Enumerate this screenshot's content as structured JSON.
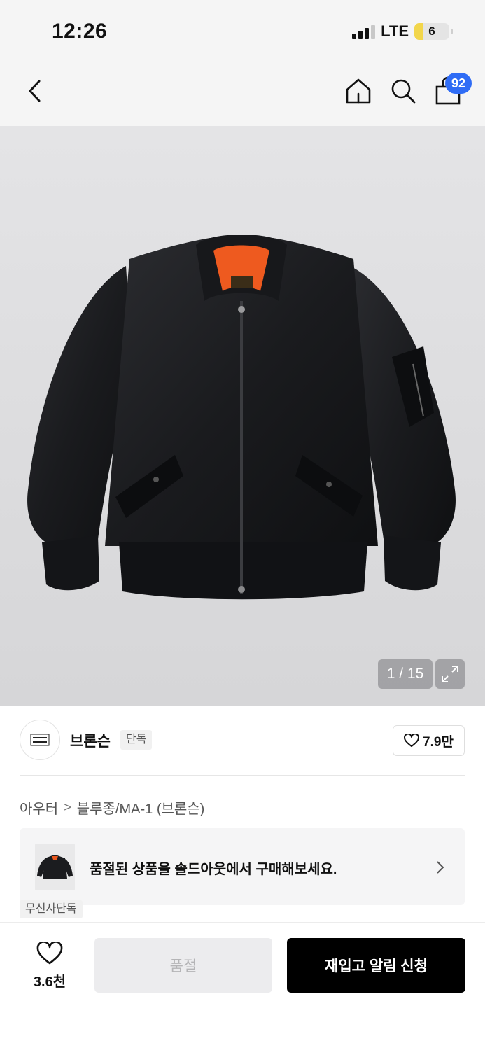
{
  "status_bar": {
    "time": "12:26",
    "network": "LTE",
    "battery": "6",
    "battery_level": 0.06,
    "signal_bars": 3
  },
  "header": {
    "back_icon": "chevron-left-icon",
    "home_icon": "home-icon",
    "search_icon": "search-icon",
    "cart_icon": "shopping-bag-icon",
    "cart_count": "92",
    "badge_color": "#2f6cf5"
  },
  "gallery": {
    "pager": "1 / 15",
    "expand_icon": "expand-icon"
  },
  "brand": {
    "name": "브론슨",
    "tag": "단독",
    "likes": "7.9만",
    "like_icon": "heart-icon"
  },
  "breadcrumb": {
    "category": "아우터",
    "separator": ">",
    "subcategory": "블루종/MA-1 (브론슨)"
  },
  "soldout_card": {
    "text": "품절된 상품을 솔드아웃에서 구매해보세요.",
    "chevron_icon": "chevron-right-icon"
  },
  "exclusive_tag": "무신사단독",
  "bottom_bar": {
    "likes": "3.6천",
    "soldout_label": "품절",
    "restock_label": "재입고 알림 신청",
    "accent_color": "#000000"
  }
}
